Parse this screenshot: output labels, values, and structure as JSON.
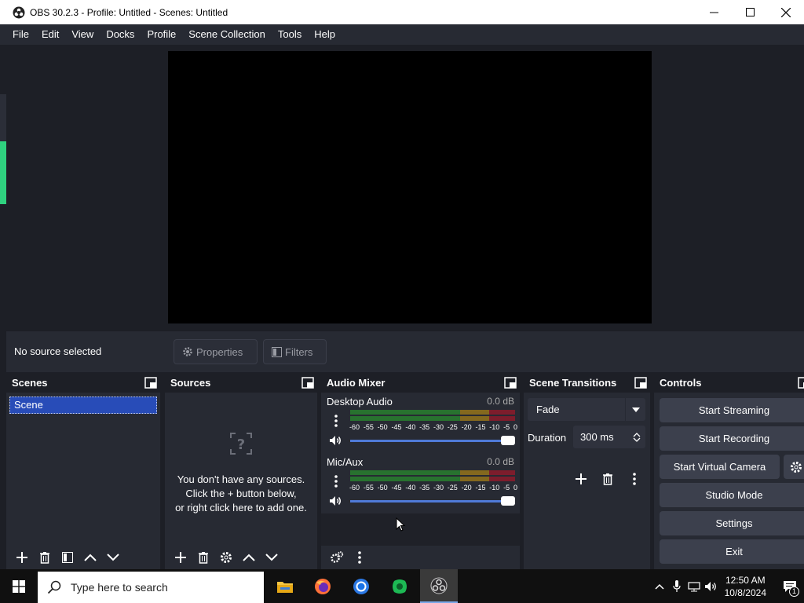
{
  "window": {
    "title": "OBS 30.2.3 - Profile: Untitled - Scenes: Untitled"
  },
  "menu": [
    "File",
    "Edit",
    "View",
    "Docks",
    "Profile",
    "Scene Collection",
    "Tools",
    "Help"
  ],
  "context_bar": {
    "status": "No source selected",
    "properties_label": "Properties",
    "filters_label": "Filters"
  },
  "scenes": {
    "title": "Scenes",
    "items": [
      "Scene"
    ]
  },
  "sources": {
    "title": "Sources",
    "empty_line1": "You don't have any sources.",
    "empty_line2": "Click the + button below,",
    "empty_line3": "or right click here to add one."
  },
  "audio_mixer": {
    "title": "Audio Mixer",
    "channels": [
      {
        "name": "Desktop Audio",
        "level": "0.0 dB",
        "volume_fraction": 1.0
      },
      {
        "name": "Mic/Aux",
        "level": "0.0 dB",
        "volume_fraction": 1.0
      }
    ],
    "ticks": [
      "-60",
      "-55",
      "-50",
      "-45",
      "-40",
      "-35",
      "-30",
      "-25",
      "-20",
      "-15",
      "-10",
      "-5",
      "0"
    ]
  },
  "transitions": {
    "title": "Scene Transitions",
    "selected": "Fade",
    "duration_label": "Duration",
    "duration_value": "300 ms"
  },
  "controls": {
    "title": "Controls",
    "start_streaming": "Start Streaming",
    "start_recording": "Start Recording",
    "start_virtual_camera": "Start Virtual Camera",
    "studio_mode": "Studio Mode",
    "settings": "Settings",
    "exit": "Exit"
  },
  "taskbar": {
    "search_placeholder": "Type here to search",
    "time": "12:50 AM",
    "date": "10/8/2024",
    "notification_count": "1"
  },
  "colors": {
    "dock_bg": "#272a33",
    "header_bg": "#1d1f26",
    "selection": "#284cb8",
    "fader": "#4f7ad8",
    "meter_green": "#28722f",
    "meter_yellow": "#84681e",
    "meter_red": "#7d1d2c"
  }
}
